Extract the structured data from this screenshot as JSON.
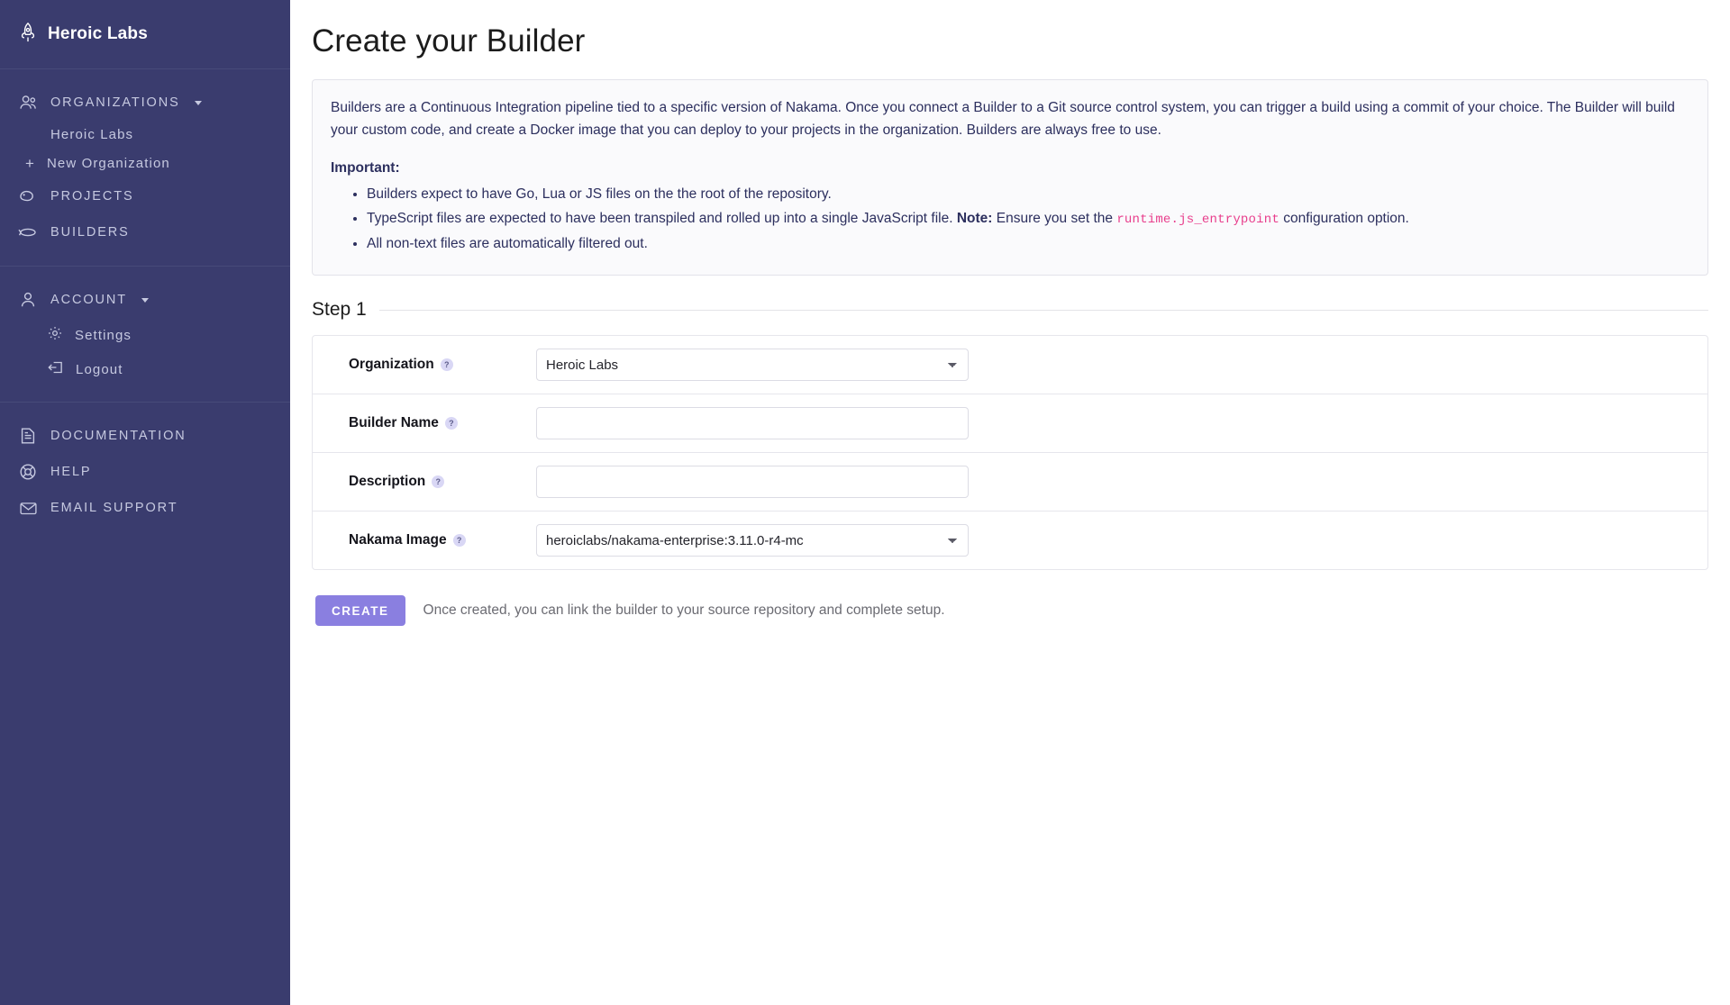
{
  "sidebar": {
    "brand": {
      "label": "Heroic Labs",
      "icon": "rocket-icon"
    },
    "groups": [
      {
        "name": "organizations-group",
        "header": {
          "label": "ORGANIZATIONS",
          "icon": "users-icon",
          "has_caret": true
        },
        "items": [
          {
            "label": "Heroic Labs",
            "type": "sub",
            "name": "sidebar-item-heroic-labs"
          },
          {
            "label": "New Organization",
            "type": "plus",
            "icon": "plus-icon",
            "name": "sidebar-item-new-organization"
          },
          {
            "label": "PROJECTS",
            "type": "nav",
            "icon": "projects-icon",
            "name": "sidebar-item-projects"
          },
          {
            "label": "BUILDERS",
            "type": "nav",
            "icon": "builders-icon",
            "name": "sidebar-item-builders"
          }
        ]
      },
      {
        "name": "account-group",
        "header": {
          "label": "ACCOUNT",
          "icon": "person-icon",
          "has_caret": true
        },
        "items": [
          {
            "label": "Settings",
            "type": "subicon",
            "icon": "gear-icon",
            "name": "sidebar-item-settings"
          },
          {
            "label": "Logout",
            "type": "subicon",
            "icon": "logout-icon",
            "name": "sidebar-item-logout"
          }
        ]
      },
      {
        "name": "support-group",
        "items": [
          {
            "label": "DOCUMENTATION",
            "type": "nav",
            "icon": "document-icon",
            "name": "sidebar-item-documentation"
          },
          {
            "label": "HELP",
            "type": "nav",
            "icon": "lifebuoy-icon",
            "name": "sidebar-item-help"
          },
          {
            "label": "EMAIL SUPPORT",
            "type": "nav",
            "icon": "envelope-icon",
            "name": "sidebar-item-email-support"
          }
        ]
      }
    ]
  },
  "main": {
    "title": "Create your Builder",
    "info": {
      "paragraph1": "Builders are a Continuous Integration pipeline tied to a specific version of Nakama. Once you connect a Builder to a Git source control system, you can trigger a build using a commit of your choice. The Builder will build your custom code, and create a Docker image that you can deploy to your projects in the organization. Builders are always free to use.",
      "important_label": "Important:",
      "bullet1": "Builders expect to have Go, Lua or JS files on the the root of the repository.",
      "bullet2_pre": "TypeScript files are expected to have been transpiled and rolled up into a single JavaScript file. ",
      "bullet2_note": "Note:",
      "bullet2_mid": " Ensure you set the ",
      "bullet2_code": "runtime.js_entrypoint",
      "bullet2_post": " configuration option.",
      "bullet3": "All non-text files are automatically filtered out."
    },
    "step": {
      "label": "Step 1"
    },
    "form": {
      "rows": [
        {
          "label": "Organization",
          "help": "?",
          "control": "select",
          "value": "Heroic Labs",
          "options": [
            "Heroic Labs"
          ],
          "name": "organization"
        },
        {
          "label": "Builder Name",
          "help": "?",
          "control": "input",
          "value": "",
          "placeholder": "",
          "name": "builder-name"
        },
        {
          "label": "Description",
          "help": "?",
          "control": "input",
          "value": "",
          "placeholder": "",
          "name": "description"
        },
        {
          "label": "Nakama Image",
          "help": "?",
          "control": "select",
          "value": "heroiclabs/nakama-enterprise:3.11.0-r4-mc",
          "options": [
            "heroiclabs/nakama-enterprise:3.11.0-r4-mc"
          ],
          "name": "nakama-image"
        }
      ]
    },
    "actions": {
      "create_label": "CREATE",
      "hint": "Once created, you can link the builder to your source repository and complete setup."
    }
  },
  "colors": {
    "sidebar_bg": "#3A3C6E",
    "accent_button": "#8A7FE0",
    "info_text": "#2C2F5E",
    "code_pink": "#E83E8C",
    "help_badge": "#D9D7F5"
  }
}
